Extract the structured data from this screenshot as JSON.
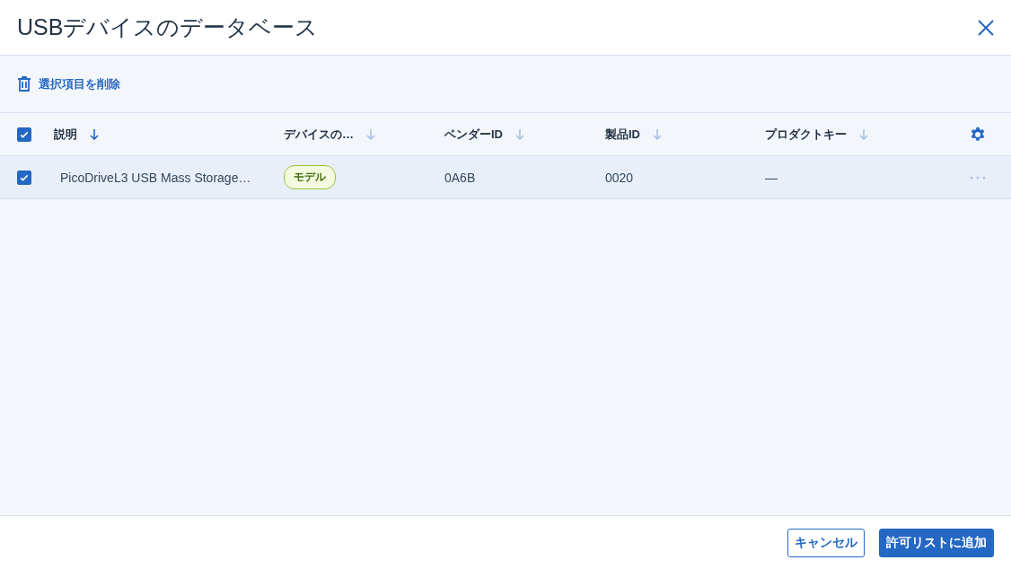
{
  "dialog": {
    "title": "USBデバイスのデータベース"
  },
  "toolbar": {
    "delete_label": "選択項目を削除"
  },
  "table": {
    "all_selected": true,
    "columns": [
      {
        "label": "説明",
        "sort_active": true
      },
      {
        "label": "デバイスの…",
        "sort_active": false
      },
      {
        "label": "ベンダーID",
        "sort_active": false
      },
      {
        "label": "製品ID",
        "sort_active": false
      },
      {
        "label": "プロダクトキー",
        "sort_active": false
      }
    ],
    "rows": [
      {
        "selected": true,
        "cells": [
          {
            "kind": "text",
            "text": "PicoDriveL3 USB Mass Storage…"
          },
          {
            "kind": "badge",
            "text": "モデル"
          },
          {
            "kind": "text",
            "text": "0A6B"
          },
          {
            "kind": "text",
            "text": "0020"
          },
          {
            "kind": "text",
            "text": "—"
          }
        ]
      }
    ]
  },
  "buttons": [
    {
      "label": "キャンセル",
      "primary": false
    },
    {
      "label": "許可リストに追加",
      "primary": true
    }
  ]
}
